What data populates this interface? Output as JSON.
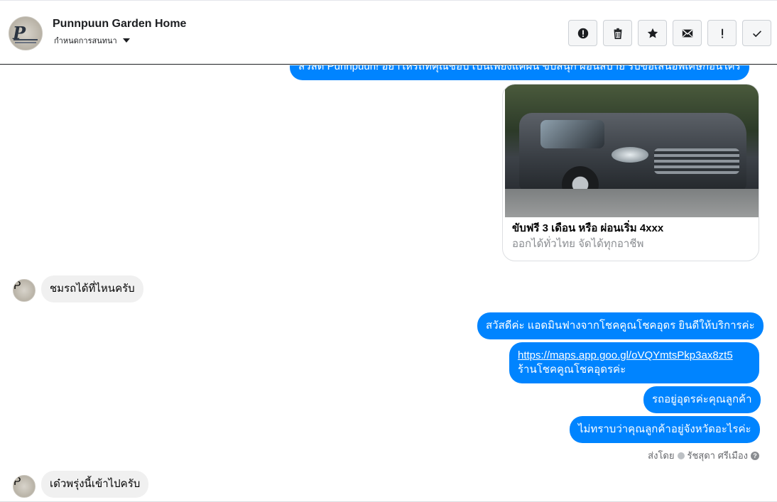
{
  "header": {
    "page_name": "Punnpuun Garden Home",
    "assign_label": "กำหนดการสนทนา",
    "toolbar": [
      {
        "name": "report-button",
        "icon": "alert-circle-icon",
        "tooltip": ""
      },
      {
        "name": "delete-button",
        "icon": "trash-icon",
        "tooltip": ""
      },
      {
        "name": "star-button",
        "icon": "star-icon",
        "tooltip": ""
      },
      {
        "name": "mark-unread-button",
        "icon": "envelope-icon",
        "tooltip": ""
      },
      {
        "name": "spam-button",
        "icon": "exclamation-icon",
        "tooltip": ""
      },
      {
        "name": "mark-done-button",
        "icon": "check-icon",
        "tooltip": ""
      }
    ]
  },
  "messages": {
    "greeting": "สวัสดี Punnpuun! อย่าให้รถที่คุณชอบ เป็นเพียงแค่ฝัน ขับสนุก ผ่อนสบาย รับข้อเสนอพิเศษก่อนใคร",
    "card": {
      "title": "ขับฟรี 3 เดือน หรือ ผ่อนเริ่ม 4xxx",
      "subtitle": "ออกได้ทั่วไทย จัดได้ทุกอาชีพ"
    },
    "incoming_1": "ชมรถได้ที่ไหนครับ",
    "outgoing_1": "สวัสดีค่ะ แอดมินฟางจากโชคคูณโชคอุดร ยินดีให้บริการค่ะ",
    "outgoing_2_link": "https://maps.app.goo.gl/oVQYmtsPkp3ax8zt5",
    "outgoing_2_text": "ร้านโชคคูณโชคอุดรค่ะ",
    "outgoing_3": "รถอยู่อุดรค่ะคุณลูกค้า",
    "outgoing_4": "ไม่ทราบว่าคุณลูกค้าอยู่จังหวัดอะไรค่ะ",
    "sent_by_label": "ส่งโดย",
    "sent_by_name": "รัชสุดา ศรีเมือง",
    "incoming_2": "เด๋วพรุ่งนี้เข้าไปครับ"
  },
  "colors": {
    "outgoing_bubble": "#0084ff",
    "incoming_bubble": "#f0f0f0"
  }
}
